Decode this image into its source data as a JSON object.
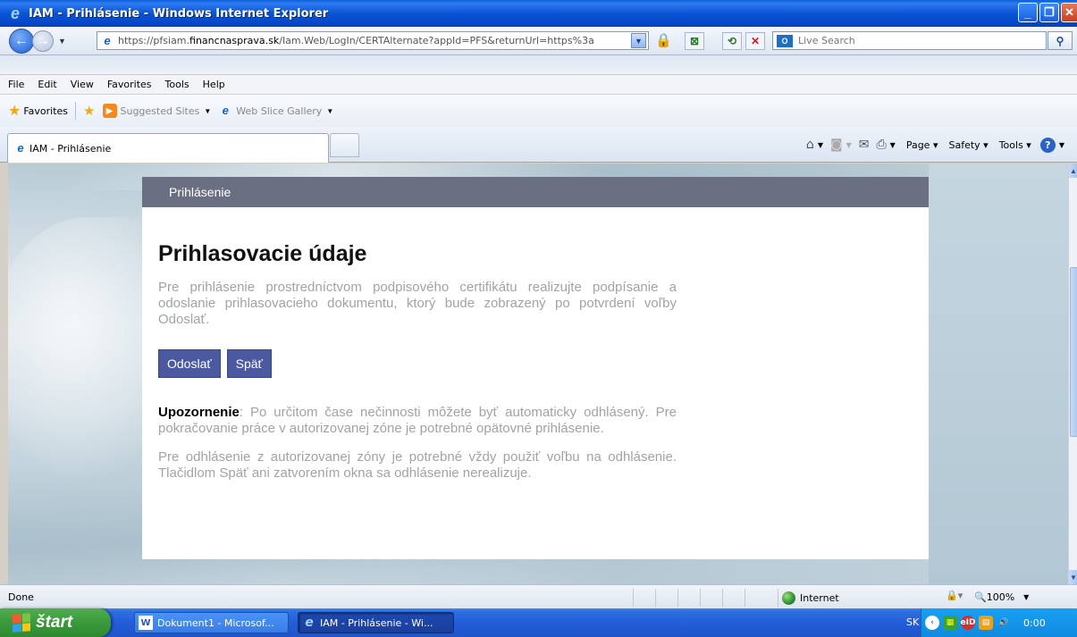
{
  "window": {
    "title": "IAM - Prihlásenie - Windows Internet Explorer"
  },
  "address": {
    "url_prefix": "https://pfsiam.",
    "url_host": "financnasprava.sk",
    "url_path": "/Iam.Web/LogIn/CERTAlternate?appId=PFS&returnUrl=https%3a",
    "search_placeholder": "Live Search"
  },
  "menu": {
    "items": [
      "File",
      "Edit",
      "View",
      "Favorites",
      "Tools",
      "Help"
    ]
  },
  "favorites": {
    "label": "Favorites",
    "suggested": "Suggested Sites",
    "webslice": "Web Slice Gallery"
  },
  "tabs": {
    "active_label": "IAM - Prihlásenie"
  },
  "commandbar": {
    "page": "Page",
    "safety": "Safety",
    "tools": "Tools"
  },
  "page": {
    "header": "Prihlásenie",
    "heading": "Prihlasovacie údaje",
    "intro": "Pre prihlásenie prostredníctvom podpisového certifikátu realizujte podpísanie a odoslanie prihlasovacieho dokumentu, ktorý bude zobrazený po potvrdení voľby Odoslať.",
    "submit_label": "Odoslať",
    "back_label": "Späť",
    "warning_title": "Upozornenie",
    "warning_text": ": Po určitom čase nečinnosti môžete byť automaticky odhlásený. Pre pokračovanie práce v autorizovanej zóne je potrebné opätovné prihlásenie.",
    "logout_text": "Pre odhlásenie z autorizovanej zóny je potrebné vždy použiť voľbu na odhlásenie. Tlačidlom Späť ani zatvorením okna sa odhlásenie nerealizuje."
  },
  "status": {
    "text": "Done",
    "zone": "Internet",
    "zoom": "100%"
  },
  "taskbar": {
    "start": "štart",
    "word_task": "Dokument1 - Microsof...",
    "ie_task": "IAM - Prihlásenie - Wi...",
    "lang": "SK",
    "clock": "0:00"
  },
  "colors": {
    "panel_header": "#6b6f82",
    "button": "#4b5aa0",
    "muted_text": "#a0a3a8"
  }
}
